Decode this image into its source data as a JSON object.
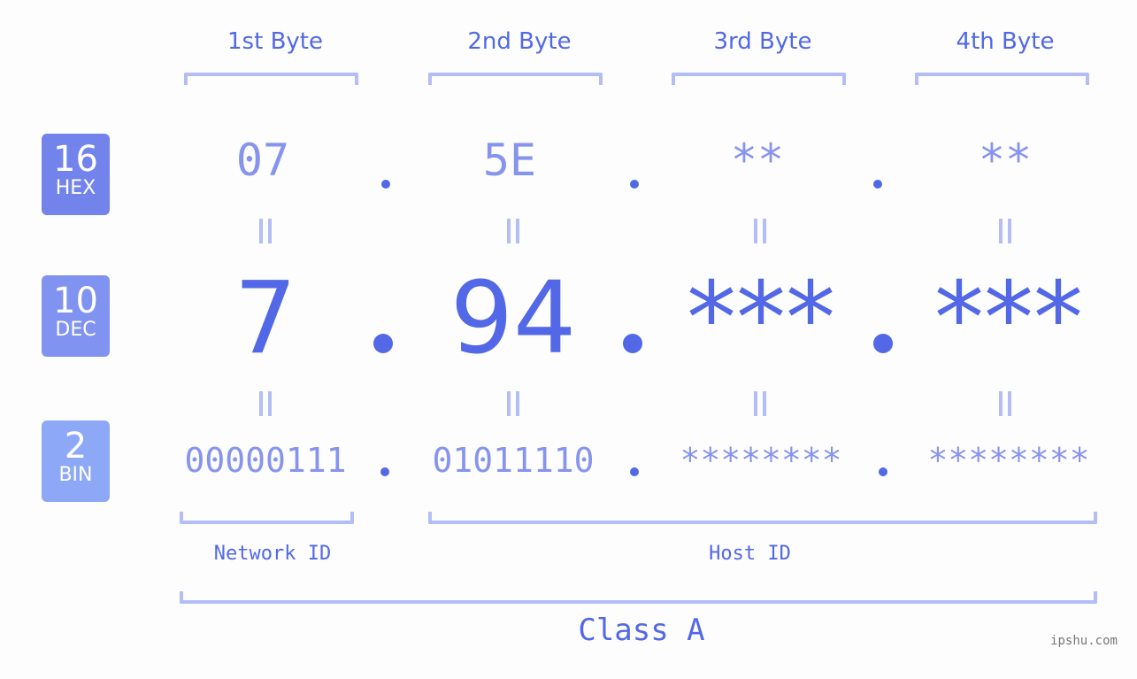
{
  "bytes": {
    "labels": [
      "1st Byte",
      "2nd Byte",
      "3rd Byte",
      "4th Byte"
    ]
  },
  "badges": {
    "hex": {
      "number": "16",
      "label": "HEX",
      "color": "#7383ec"
    },
    "dec": {
      "number": "10",
      "label": "DEC",
      "color": "#8193f1"
    },
    "bin": {
      "number": "2",
      "label": "BIN",
      "color": "#8ea8f8"
    }
  },
  "hex": {
    "values": [
      "07",
      "5E",
      "**",
      "**"
    ]
  },
  "dec": {
    "values": [
      "7",
      "94",
      "***",
      "***"
    ]
  },
  "bin": {
    "values": [
      "00000111",
      "01011110",
      "********",
      "********"
    ]
  },
  "ids": {
    "network": "Network ID",
    "host": "Host ID"
  },
  "class_label": "Class A",
  "watermark": "ipshu.com",
  "colors": {
    "primary": "#5268e6",
    "secondary": "#8794ee",
    "bracket": "#b3bdf6"
  }
}
